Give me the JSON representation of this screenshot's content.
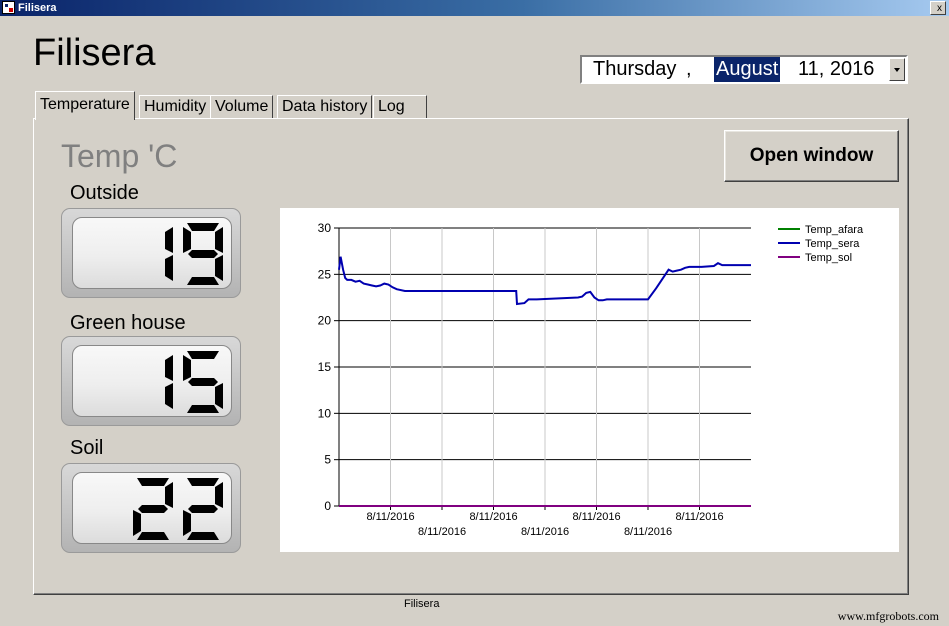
{
  "window": {
    "title": "Filisera",
    "close_label": "x"
  },
  "app_title": "Filisera",
  "date_picker": {
    "day": "Thursday",
    "sep": ",",
    "month": "August",
    "rest": "11, 2016"
  },
  "tabs": [
    {
      "label": "Temperature",
      "active": true
    },
    {
      "label": "Humidity",
      "active": false
    },
    {
      "label": "Volume",
      "active": false
    },
    {
      "label": "Data history",
      "active": false
    },
    {
      "label": "Log",
      "active": false
    }
  ],
  "panel": {
    "title": "Temp 'C",
    "open_button": "Open window",
    "sensors": [
      {
        "label": "Outside",
        "value": "19"
      },
      {
        "label": "Green house",
        "value": "15"
      },
      {
        "label": "Soil",
        "value": "22"
      }
    ]
  },
  "chart_data": {
    "type": "line",
    "ylim": [
      0,
      30
    ],
    "yticks": [
      0,
      5,
      10,
      15,
      20,
      25,
      30
    ],
    "x_ticks": [
      {
        "label": "8/11/2016",
        "row": 0
      },
      {
        "label": "8/11/2016",
        "row": 1
      },
      {
        "label": "8/11/2016",
        "row": 0
      },
      {
        "label": "8/11/2016",
        "row": 1
      },
      {
        "label": "8/11/2016",
        "row": 0
      },
      {
        "label": "8/11/2016",
        "row": 1
      },
      {
        "label": "8/11/2016",
        "row": 0
      }
    ],
    "grid": true,
    "legend_position": "top-right",
    "series": [
      {
        "name": "Temp_afara",
        "color": "#008000",
        "x": [
          0,
          100
        ],
        "values": [
          0,
          0
        ]
      },
      {
        "name": "Temp_sera",
        "color": "#0000b0",
        "x": [
          0,
          0.4,
          1,
          1.5,
          2,
          3,
          4,
          5,
          6,
          7,
          8,
          9,
          10,
          11,
          12,
          13,
          14,
          16,
          18,
          40,
          43,
          43.2,
          45,
          46,
          48,
          58,
          59,
          60,
          61,
          62,
          63,
          64,
          65,
          75,
          77,
          80,
          81,
          82,
          83,
          84,
          85,
          86,
          87,
          88,
          91,
          92,
          93,
          100
        ],
        "values": [
          25.5,
          26.9,
          25.5,
          24.6,
          24.4,
          24.4,
          24.2,
          24.3,
          24,
          23.9,
          23.8,
          23.7,
          23.8,
          24,
          23.9,
          23.6,
          23.4,
          23.2,
          23.2,
          23.2,
          23.2,
          21.8,
          21.9,
          22.3,
          22.3,
          22.5,
          22.6,
          23,
          23.1,
          22.5,
          22.2,
          22.2,
          22.3,
          22.3,
          23.5,
          25.5,
          25.3,
          25.4,
          25.5,
          25.7,
          25.8,
          25.8,
          25.8,
          25.8,
          25.9,
          26.2,
          26,
          26
        ]
      },
      {
        "name": "Temp_sol",
        "color": "#800080",
        "x": [
          0,
          100
        ],
        "values": [
          0,
          0
        ]
      }
    ]
  },
  "status_text": "Filisera",
  "watermark": "www.mfgrobots.com"
}
